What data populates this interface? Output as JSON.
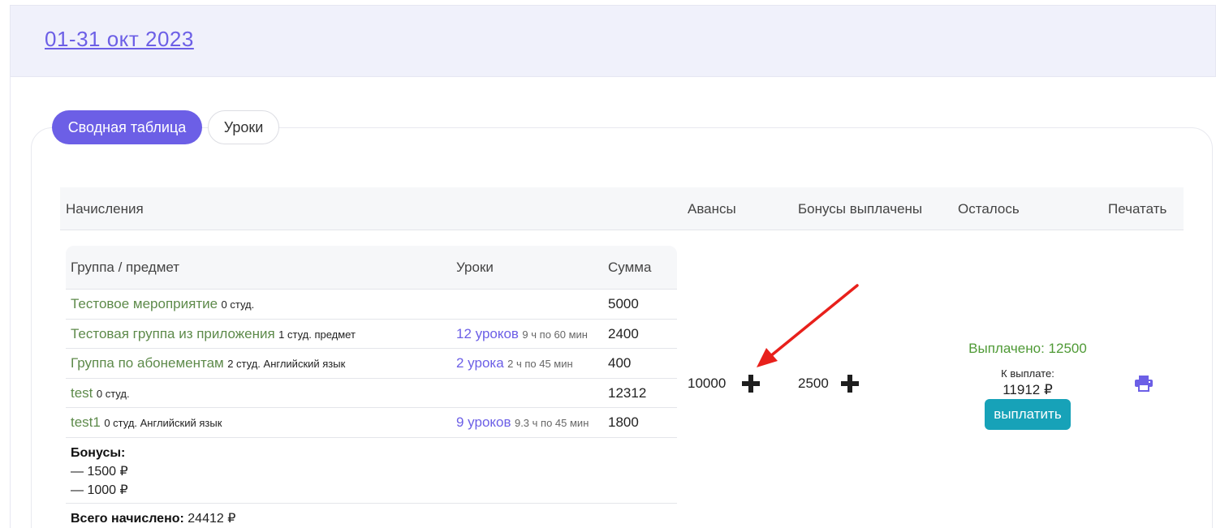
{
  "header": {
    "period": "01-31 окт 2023"
  },
  "tabs": [
    {
      "label": "Сводная таблица",
      "active": true
    },
    {
      "label": "Уроки",
      "active": false
    }
  ],
  "main_table": {
    "headers": {
      "accruals": "Начисления",
      "advances": "Авансы",
      "bonuses_paid": "Бонусы выплачены",
      "remaining": "Осталось",
      "print": "Печатать"
    }
  },
  "accruals_table": {
    "headers": {
      "group": "Группа / предмет",
      "lessons": "Уроки",
      "sum": "Сумма"
    },
    "rows": [
      {
        "name": "Тестовое мероприятие",
        "meta": "0 студ.",
        "lessons": "",
        "lessons_meta": "",
        "sum": "5000"
      },
      {
        "name": "Тестовая группа из приложения",
        "meta": "1 студ. предмет",
        "lessons": "12 уроков",
        "lessons_meta": "9 ч по 60 мин",
        "sum": "2400"
      },
      {
        "name": "Группа по абонементам",
        "meta": "2 студ. Английский язык",
        "lessons": "2 урока",
        "lessons_meta": "2 ч по 45 мин",
        "sum": "400"
      },
      {
        "name": "test",
        "meta": "0 студ.",
        "lessons": "",
        "lessons_meta": "",
        "sum": "12312"
      },
      {
        "name": "test1",
        "meta": "0 студ. Английский язык",
        "lessons": "9 уроков",
        "lessons_meta": "9.3 ч по 45 мин",
        "sum": "1800"
      }
    ],
    "bonuses": {
      "title": "Бонусы:",
      "items": [
        "— 1500 ₽",
        "— 1000 ₽"
      ]
    },
    "total": {
      "label": "Всего начислено:",
      "value": "24412 ₽"
    }
  },
  "advances": {
    "value": "10000",
    "add_icon": "plus-icon"
  },
  "bonuses_paid": {
    "value": "2500",
    "add_icon": "plus-icon"
  },
  "remaining": {
    "paid": "Выплачено: 12500",
    "to_pay_label": "К выплате:",
    "to_pay_value": "11912 ₽",
    "pay_button": "выплатить"
  },
  "print": {
    "icon": "printer-icon"
  },
  "colors": {
    "accent": "#6c5fe6",
    "group_name": "#5d8a4a",
    "paid_text": "#4f9a36",
    "pay_button": "#17a2b8",
    "annotation_arrow": "#e8201b"
  }
}
